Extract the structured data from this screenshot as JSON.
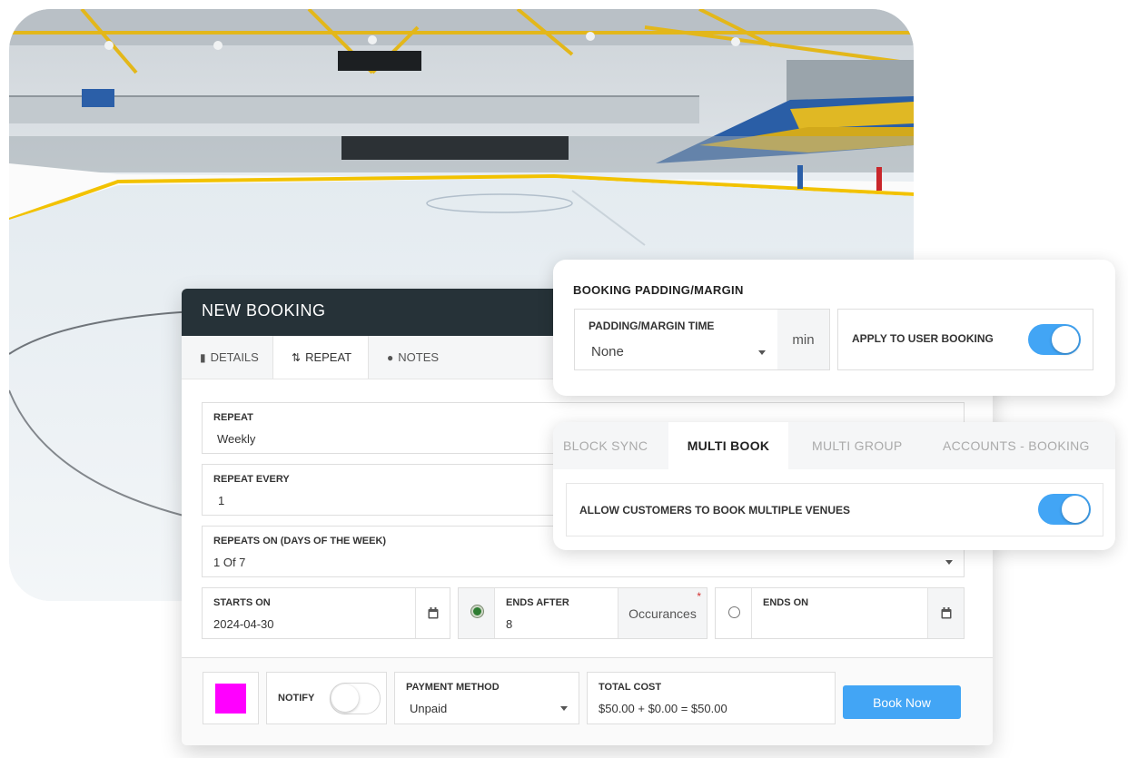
{
  "booking": {
    "title": "NEW BOOKING",
    "tabs": [
      {
        "label": "DETAILS",
        "icon": "file-icon"
      },
      {
        "label": "REPEAT",
        "icon": "repeat-icon",
        "active": true
      },
      {
        "label": "NOTES",
        "icon": "comment-icon"
      }
    ],
    "repeat": {
      "label": "REPEAT",
      "value": "Weekly"
    },
    "repeat_every": {
      "label": "REPEAT EVERY",
      "value": "1"
    },
    "repeats_on": {
      "label": "REPEATS ON (DAYS OF THE WEEK)",
      "value": "1 Of 7"
    },
    "starts_on": {
      "label": "STARTS ON",
      "value": "2024-04-30"
    },
    "ends_after": {
      "label": "ENDS AFTER",
      "value": "8",
      "suffix": "Occurances",
      "required": "*",
      "selected": true
    },
    "ends_on": {
      "label": "ENDS ON",
      "value": "",
      "selected": false
    },
    "color_swatch": "#ff00ff",
    "notify": {
      "label": "NOTIFY",
      "on": false
    },
    "payment_method": {
      "label": "PAYMENT METHOD",
      "value": "Unpaid"
    },
    "total_cost": {
      "label": "TOTAL COST",
      "value": "$50.00 + $0.00 = $50.00"
    },
    "book_button": "Book Now"
  },
  "padding_panel": {
    "title": "BOOKING PADDING/MARGIN",
    "time_label": "PADDING/MARGIN TIME",
    "time_value": "None",
    "unit": "min",
    "apply_label": "APPLY TO USER BOOKING",
    "apply_on": true
  },
  "multibook_panel": {
    "tabs": [
      {
        "label": "BLOCK SYNC"
      },
      {
        "label": "MULTI BOOK",
        "active": true
      },
      {
        "label": "MULTI GROUP"
      },
      {
        "label": "ACCOUNTS - BOOKING"
      }
    ],
    "allow_label": "ALLOW CUSTOMERS TO BOOK MULTIPLE VENUES",
    "allow_on": true
  },
  "colors": {
    "accent": "#42a5f5",
    "header": "#263238",
    "rink_yellow": "#f2c200"
  }
}
